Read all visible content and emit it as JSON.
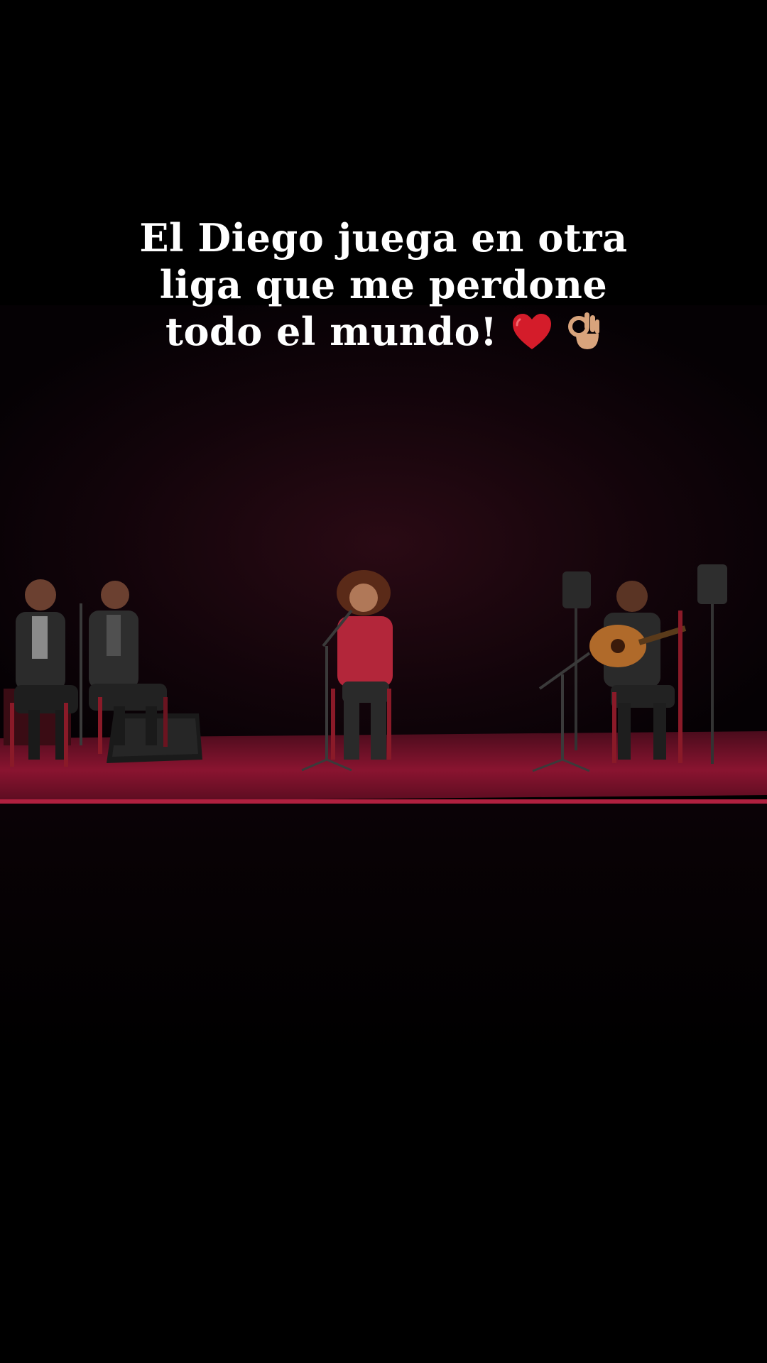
{
  "caption": {
    "line1": "El Diego juega en otra",
    "line2": "liga que me perdone",
    "line3": "todo el mundo!"
  },
  "icons": {
    "heart": "red-heart-icon",
    "ok_hand": "ok-hand-icon"
  },
  "colors": {
    "background": "#000000",
    "stage_floor": "#7a0f2a",
    "stage_edge": "#b0203f",
    "singer_dress": "#b3263a",
    "heart": "#d41c2a",
    "ok_hand_skin": "#d9a47c",
    "caption_text": "#ffffff"
  }
}
